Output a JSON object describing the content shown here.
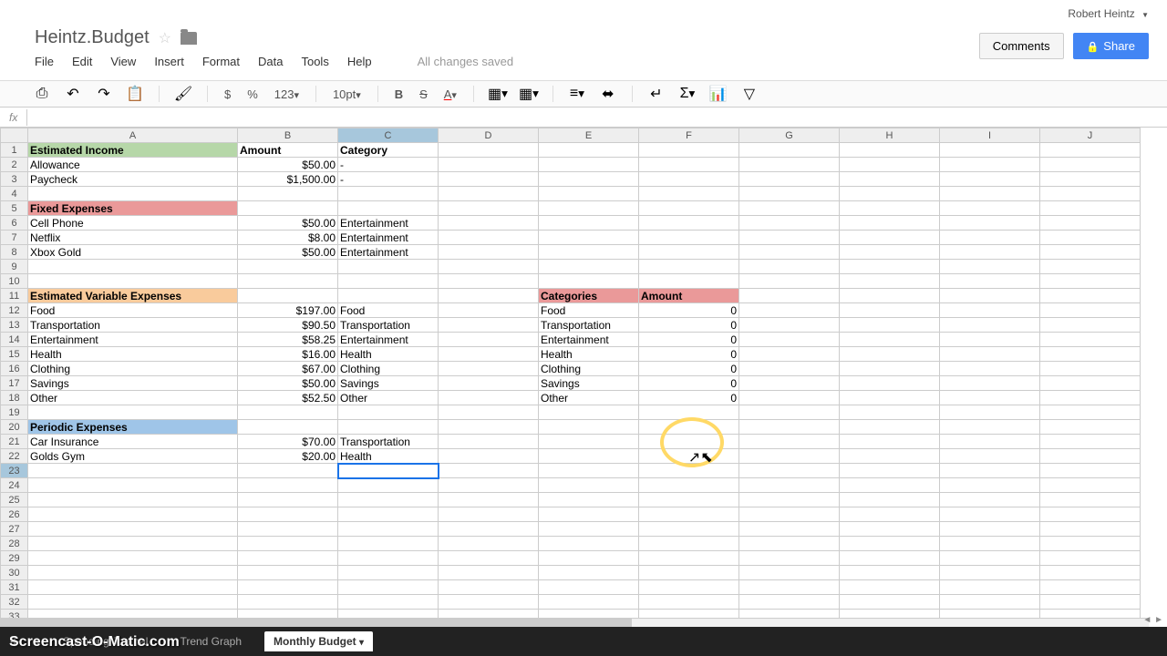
{
  "user": "Robert Heintz",
  "docTitle": "Heintz.Budget",
  "menus": {
    "file": "File",
    "edit": "Edit",
    "view": "View",
    "insert": "Insert",
    "format": "Format",
    "data": "Data",
    "tools": "Tools",
    "help": "Help"
  },
  "saveStatus": "All changes saved",
  "buttons": {
    "comments": "Comments",
    "share": "Share"
  },
  "toolbar": {
    "currency": "$",
    "percent": "%",
    "num": "123",
    "font": "10pt"
  },
  "fx": "fx",
  "columns": [
    "A",
    "B",
    "C",
    "D",
    "E",
    "F",
    "G",
    "H",
    "I",
    "J"
  ],
  "rows": [
    {
      "n": 1,
      "A": "Estimated Income",
      "B": "Amount",
      "C": "Category",
      "aCls": "hdr-green",
      "bold": true
    },
    {
      "n": 2,
      "A": "Allowance",
      "B": "$50.00",
      "C": "-",
      "bNum": true
    },
    {
      "n": 3,
      "A": "Paycheck",
      "B": "$1,500.00",
      "C": "-",
      "bNum": true
    },
    {
      "n": 4
    },
    {
      "n": 5,
      "A": "Fixed Expenses",
      "aCls": "hdr-red"
    },
    {
      "n": 6,
      "A": "Cell Phone",
      "B": "$50.00",
      "C": "Entertainment",
      "bNum": true
    },
    {
      "n": 7,
      "A": "Netflix",
      "B": "$8.00",
      "C": "Entertainment",
      "bNum": true
    },
    {
      "n": 8,
      "A": "Xbox Gold",
      "B": "$50.00",
      "C": "Entertainment",
      "bNum": true
    },
    {
      "n": 9
    },
    {
      "n": 10
    },
    {
      "n": 11,
      "A": "Estimated Variable Expenses",
      "aCls": "hdr-orange",
      "E": "Categories",
      "F": "Amount",
      "efHdr": true
    },
    {
      "n": 12,
      "A": "Food",
      "B": "$197.00",
      "C": "Food",
      "bNum": true,
      "E": "Food",
      "F": "0",
      "fNum": true
    },
    {
      "n": 13,
      "A": "Transportation",
      "B": "$90.50",
      "C": "Transportation",
      "bNum": true,
      "E": "Transportation",
      "F": "0",
      "fNum": true
    },
    {
      "n": 14,
      "A": "Entertainment",
      "B": "$58.25",
      "C": "Entertainment",
      "bNum": true,
      "E": "Entertainment",
      "F": "0",
      "fNum": true
    },
    {
      "n": 15,
      "A": "Health",
      "B": "$16.00",
      "C": "Health",
      "bNum": true,
      "E": "Health",
      "F": "0",
      "fNum": true
    },
    {
      "n": 16,
      "A": "Clothing",
      "B": "$67.00",
      "C": "Clothing",
      "bNum": true,
      "E": "Clothing",
      "F": "0",
      "fNum": true
    },
    {
      "n": 17,
      "A": "Savings",
      "B": "$50.00",
      "C": "Savings",
      "bNum": true,
      "E": "Savings",
      "F": "0",
      "fNum": true
    },
    {
      "n": 18,
      "A": "Other",
      "B": "$52.50",
      "C": "Other",
      "bNum": true,
      "E": "Other",
      "F": "0",
      "fNum": true
    },
    {
      "n": 19
    },
    {
      "n": 20,
      "A": "Periodic Expenses",
      "aCls": "hdr-blue"
    },
    {
      "n": 21,
      "A": "Car Insurance",
      "B": "$70.00",
      "C": "Transportation",
      "bNum": true
    },
    {
      "n": 22,
      "A": "Golds Gym",
      "B": "$20.00",
      "C": "Health",
      "bNum": true
    },
    {
      "n": 23,
      "selected": true
    },
    {
      "n": 24
    },
    {
      "n": 25
    },
    {
      "n": 26
    },
    {
      "n": 27
    },
    {
      "n": 28
    },
    {
      "n": 29
    },
    {
      "n": 30
    },
    {
      "n": 31
    },
    {
      "n": 32
    },
    {
      "n": 33
    }
  ],
  "tabs": {
    "t1": "Spending Journal",
    "t2": "Trend Graph",
    "t3": "Monthly Budget"
  },
  "watermark": "Screencast-O-Matic.com"
}
